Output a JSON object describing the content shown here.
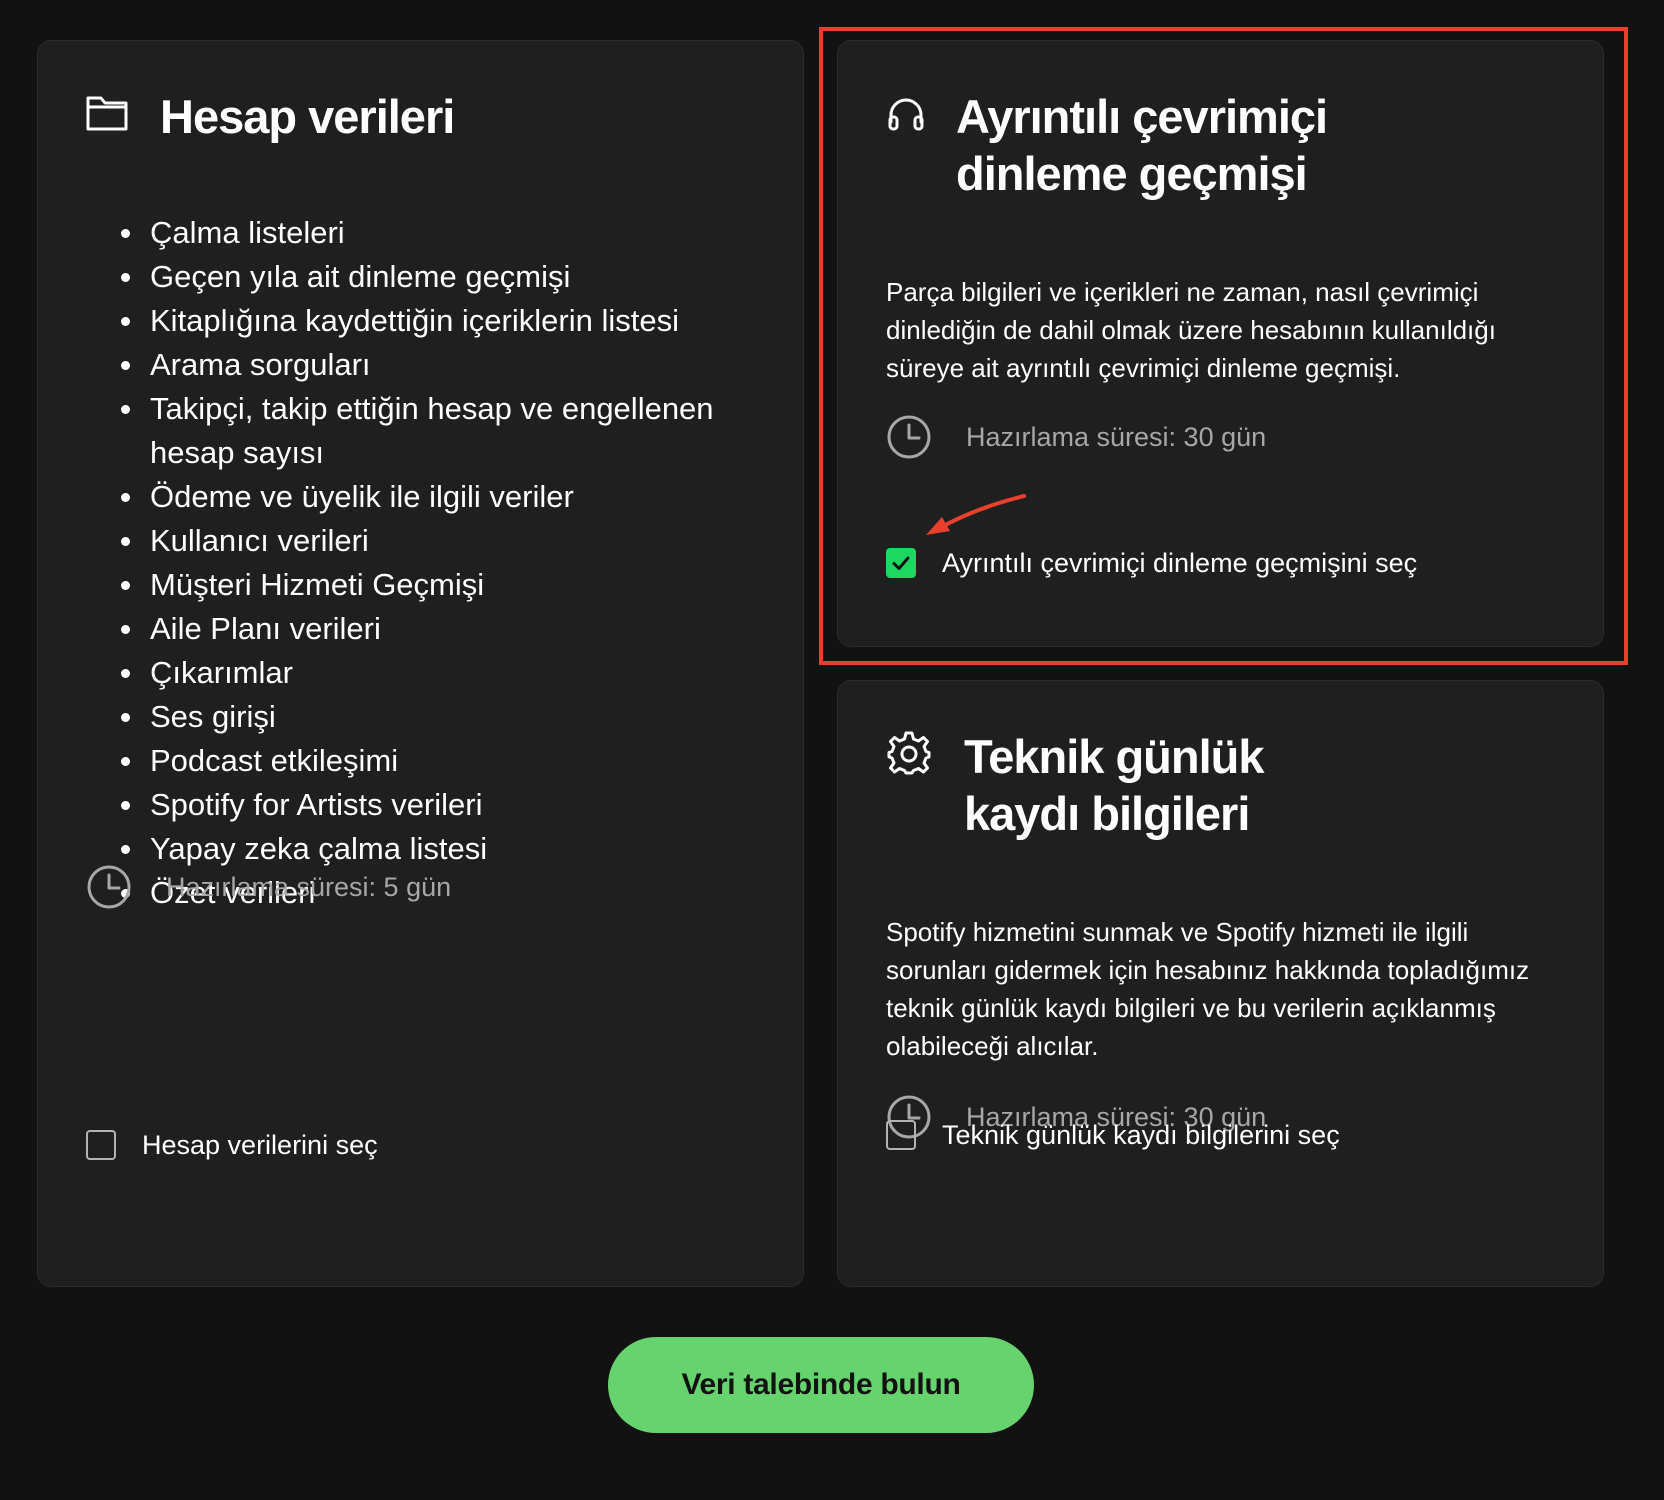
{
  "colors": {
    "background": "#121212",
    "card": "#1f1f1f",
    "accent_green": "#1ed760",
    "button_green": "#66d36e",
    "highlight_red": "#e8402d",
    "muted_text": "#a7a7a7"
  },
  "account_card": {
    "icon": "folder-icon",
    "title": "Hesap verileri",
    "items": [
      "Çalma listeleri",
      "Geçen yıla ait dinleme geçmişi",
      "Kitaplığına kaydettiğin içeriklerin listesi",
      "Arama sorguları",
      "Takipçi, takip ettiğin hesap ve engellenen hesap sayısı",
      "Ödeme ve üyelik ile ilgili veriler",
      "Kullanıcı verileri",
      "Müşteri Hizmeti Geçmişi",
      "Aile Planı verileri",
      "Çıkarımlar",
      "Ses girişi",
      "Podcast etkileşimi",
      "Spotify for Artists verileri",
      "Yapay zeka çalma listesi",
      "Özet verileri"
    ],
    "prep_time": "Hazırlama süresi: 5 gün",
    "checkbox_label": "Hesap verilerini seç",
    "checked": false
  },
  "extended_card": {
    "icon": "headphones-icon",
    "title_line1": "Ayrıntılı çevrimiçi",
    "title_line2": "dinleme geçmişi",
    "description": "Parça bilgileri ve içerikleri ne zaman, nasıl çevrimiçi dinlediğin de dahil olmak üzere hesabının kullanıldığı süreye ait ayrıntılı çevrimiçi dinleme geçmişi.",
    "prep_time": "Hazırlama süresi: 30 gün",
    "checkbox_label": "Ayrıntılı çevrimiçi dinleme geçmişini seç",
    "checked": true
  },
  "technical_card": {
    "icon": "gear-icon",
    "title_line1": "Teknik günlük",
    "title_line2": "kaydı bilgileri",
    "description": "Spotify hizmetini sunmak ve Spotify hizmeti ile ilgili sorunları gidermek için hesabınız hakkında topladığımız teknik günlük kaydı bilgileri ve bu verilerin açıklanmış olabileceği alıcılar.",
    "prep_time": "Hazırlama süresi: 30 gün",
    "checkbox_label": "Teknik günlük kaydı bilgilerini seç",
    "checked": false
  },
  "submit_button": {
    "label": "Veri talebinde bulun"
  }
}
